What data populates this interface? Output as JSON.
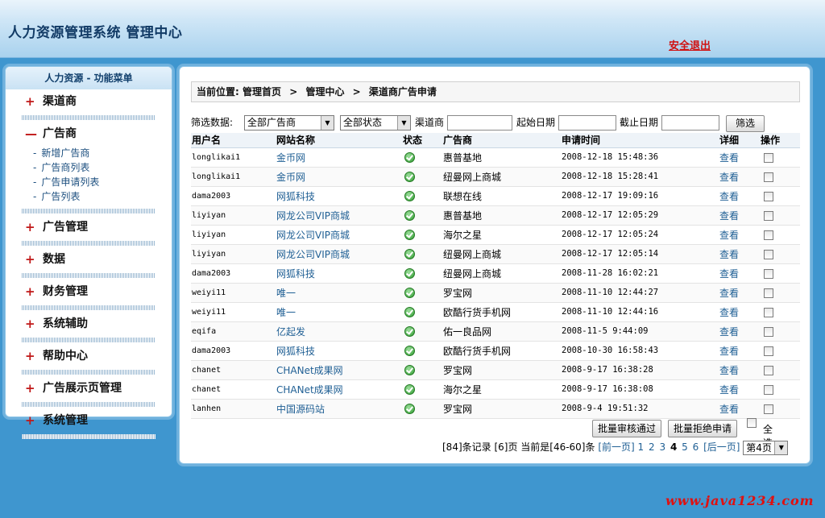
{
  "header": {
    "title": "人力资源管理系统 管理中心",
    "logout_label": "安全退出"
  },
  "sidebar": {
    "menu_title": "人力资源 - 功能菜单",
    "groups": [
      {
        "label": "渠道商",
        "expanded": false,
        "sign": "+"
      },
      {
        "label": "广告商",
        "expanded": true,
        "sign": "—",
        "items": [
          "新增广告商",
          "广告商列表",
          "广告申请列表",
          "广告列表"
        ]
      },
      {
        "label": "广告管理",
        "expanded": false,
        "sign": "+"
      },
      {
        "label": "数据",
        "expanded": false,
        "sign": "+"
      },
      {
        "label": "财务管理",
        "expanded": false,
        "sign": "+"
      },
      {
        "label": "系统辅助",
        "expanded": false,
        "sign": "+"
      },
      {
        "label": "帮助中心",
        "expanded": false,
        "sign": "+"
      },
      {
        "label": "广告展示页管理",
        "expanded": false,
        "sign": "+"
      },
      {
        "label": "系统管理",
        "expanded": false,
        "sign": "+"
      }
    ],
    "sub_dash": "-"
  },
  "breadcrumb": {
    "prefix": "当前位置:",
    "items": [
      "管理首页",
      "管理中心",
      "渠道商广告申请"
    ],
    "separator": ">"
  },
  "filter": {
    "label": "筛选数据:",
    "advertiser_select": "全部广告商",
    "status_select": "全部状态",
    "channel_label": "渠道商",
    "start_label": "起始日期",
    "end_label": "截止日期",
    "submit_label": "筛选"
  },
  "table": {
    "columns": [
      "用户名",
      "网站名称",
      "状态",
      "广告商",
      "申请时间",
      "详细",
      "操作"
    ],
    "view_label": "查看",
    "rows": [
      {
        "user": "longlikai1",
        "site": "金币网",
        "advertiser": "惠普基地",
        "time": "2008-12-18 15:48:36"
      },
      {
        "user": "longlikai1",
        "site": "金币网",
        "advertiser": "纽曼网上商城",
        "time": "2008-12-18 15:28:41"
      },
      {
        "user": "dama2003",
        "site": "网狐科技",
        "advertiser": "联想在线",
        "time": "2008-12-17 19:09:16"
      },
      {
        "user": "liyiyan",
        "site": "网龙公司VIP商城",
        "advertiser": "惠普基地",
        "time": "2008-12-17 12:05:29"
      },
      {
        "user": "liyiyan",
        "site": "网龙公司VIP商城",
        "advertiser": "海尔之星",
        "time": "2008-12-17 12:05:24"
      },
      {
        "user": "liyiyan",
        "site": "网龙公司VIP商城",
        "advertiser": "纽曼网上商城",
        "time": "2008-12-17 12:05:14"
      },
      {
        "user": "dama2003",
        "site": "网狐科技",
        "advertiser": "纽曼网上商城",
        "time": "2008-11-28 16:02:21"
      },
      {
        "user": "weiyi11",
        "site": "唯一",
        "advertiser": "罗宝网",
        "time": "2008-11-10 12:44:27"
      },
      {
        "user": "weiyi11",
        "site": "唯一",
        "advertiser": "欧酷行货手机网",
        "time": "2008-11-10 12:44:16"
      },
      {
        "user": "eqifa",
        "site": "亿起发",
        "advertiser": "佑一良品网",
        "time": "2008-11-5 9:44:09"
      },
      {
        "user": "dama2003",
        "site": "网狐科技",
        "advertiser": "欧酷行货手机网",
        "time": "2008-10-30 16:58:43"
      },
      {
        "user": "chanet",
        "site": "CHANet成果网",
        "advertiser": "罗宝网",
        "time": "2008-9-17 16:38:28"
      },
      {
        "user": "chanet",
        "site": "CHANet成果网",
        "advertiser": "海尔之星",
        "time": "2008-9-17 16:38:08"
      },
      {
        "user": "lanhen",
        "site": "中国源码站",
        "advertiser": "罗宝网",
        "time": "2008-9-4 19:51:32"
      }
    ]
  },
  "actions": {
    "approve_label": "批量审核通过",
    "reject_label": "批量拒绝申请",
    "select_all_label": "全选"
  },
  "pager": {
    "summary": "[84]条记录 [6]页 当前是[46-60]条",
    "prev_label": "[前一页]",
    "pages": [
      "1",
      "2",
      "3",
      "4",
      "5",
      "6"
    ],
    "current_page": "4",
    "next_label": "[后一页]",
    "page_select": "第4页"
  },
  "watermark": "www.java1234.com",
  "colors": {
    "background": "#3f96cf",
    "link": "#1f5f94",
    "logout": "#d01010",
    "status_ok": "#2e9a2e"
  }
}
